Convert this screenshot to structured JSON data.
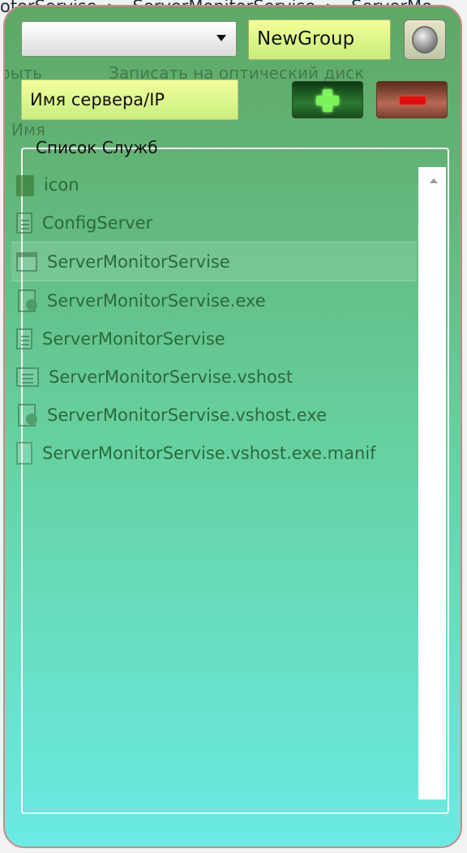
{
  "background_window": {
    "breadcrumb": [
      "otorServise",
      "ServerMonitorServise",
      "ServerMo"
    ],
    "toolbar_left": "рыть",
    "toolbar_burn": "Записать на оптический диск",
    "column_name": "Имя"
  },
  "controls": {
    "group_combo_value": "",
    "group_name": "NewGroup",
    "server_field": "Имя сервера/IP",
    "add_icon": "plus-icon",
    "remove_icon": "minus-icon",
    "settings_icon": "gear-knob-icon"
  },
  "services": {
    "title": "Список Служб",
    "items": [
      {
        "name": "icon",
        "icon": "folder-icon"
      },
      {
        "name": "ConfigServer",
        "icon": "document-icon"
      },
      {
        "name": "ServerMonitorServise",
        "icon": "application-icon"
      },
      {
        "name": "ServerMonitorServise.exe",
        "icon": "exe-icon"
      },
      {
        "name": "ServerMonitorServise",
        "icon": "document-icon"
      },
      {
        "name": "ServerMonitorServise.vshost",
        "icon": "config-icon"
      },
      {
        "name": "ServerMonitorServise.vshost.exe",
        "icon": "exe-icon"
      },
      {
        "name": "ServerMonitorServise.vshost.exe.manif",
        "icon": "blank-file-icon"
      }
    ]
  },
  "colors": {
    "gadget_top": "#5fa866",
    "gadget_bottom": "#6aeae4",
    "field_yellow": "#f2ff9a",
    "add_green": "#7af25a",
    "remove_red": "#e01010"
  }
}
